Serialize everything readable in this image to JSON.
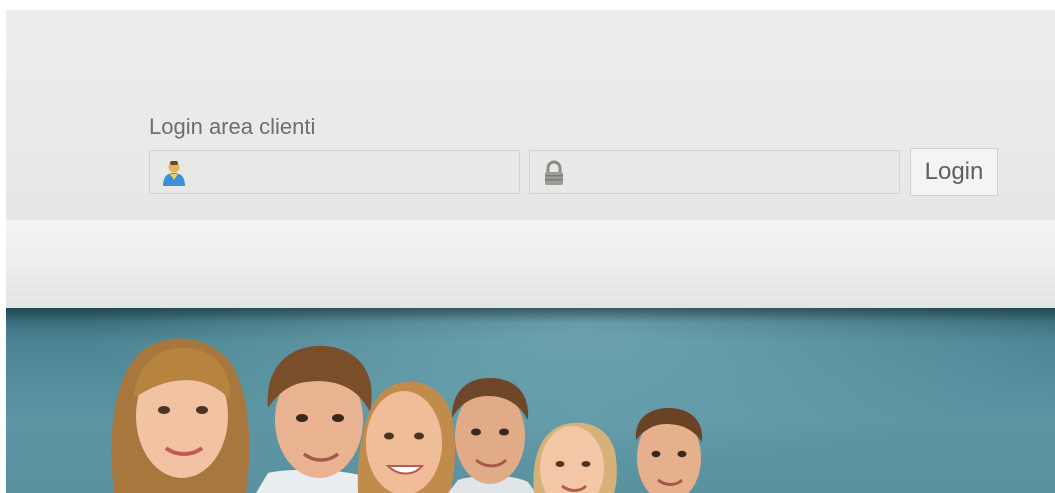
{
  "login": {
    "title": "Login area clienti",
    "username": {
      "placeholder": "",
      "value": "",
      "icon": "user-icon"
    },
    "password": {
      "placeholder": "",
      "value": "",
      "icon": "lock-icon"
    },
    "button_label": "Login"
  },
  "colors": {
    "header_bg": "#ebebe9",
    "hero_teal": "#5a92a0",
    "text_gray": "#6e6e6e"
  },
  "hero": {
    "image": "group-of-smiling-people"
  }
}
